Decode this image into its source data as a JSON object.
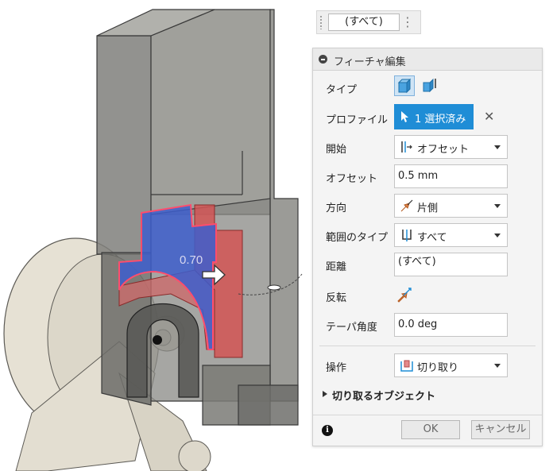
{
  "viewport": {
    "dimension_value": "0.70"
  },
  "distance_widget": {
    "value": "(すべて)"
  },
  "dialog": {
    "title": "フィーチャ編集",
    "rows": {
      "type": {
        "label": "タイプ"
      },
      "profile": {
        "label": "プロファイル",
        "selection": "1 選択済み"
      },
      "start": {
        "label": "開始",
        "value": "オフセット"
      },
      "offset": {
        "label": "オフセット",
        "value": "0.5 mm"
      },
      "direction": {
        "label": "方向",
        "value": "片側"
      },
      "extent_type": {
        "label": "範囲のタイプ",
        "value": "すべて"
      },
      "distance": {
        "label": "距離",
        "value": "(すべて)"
      },
      "flip": {
        "label": "反転"
      },
      "taper": {
        "label": "テーパ角度",
        "value": "0.0 deg"
      },
      "operation": {
        "label": "操作",
        "value": "切り取り"
      }
    },
    "objects_to_cut": "切り取るオブジェクト",
    "ok_label": "OK",
    "cancel_label": "キャンセル"
  },
  "colors": {
    "accent": "#1f8dd6",
    "profile_blue": "#3d5ecc",
    "profile_red": "#d25555",
    "body_gray": "#8a8a86",
    "part_beige": "#e6e1d4"
  }
}
